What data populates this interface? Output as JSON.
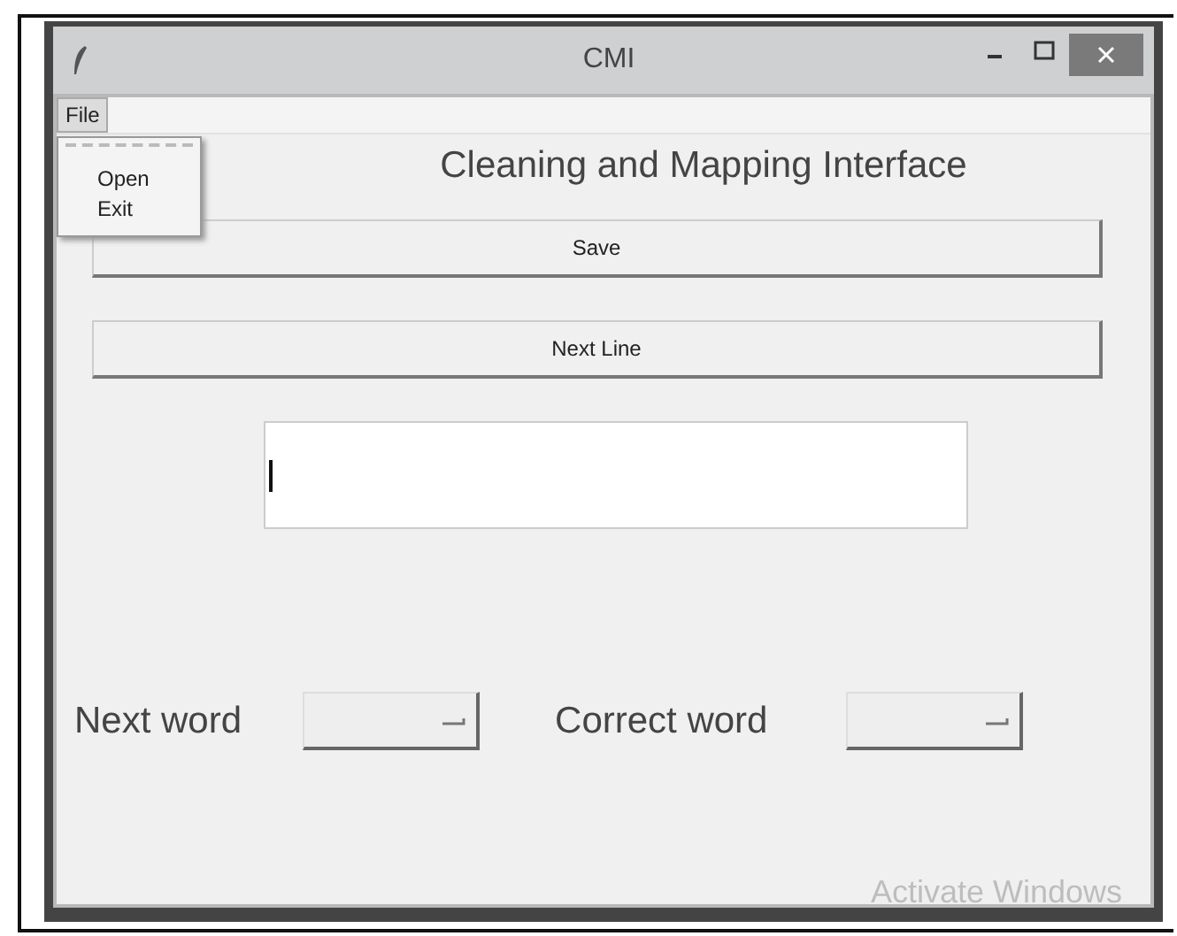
{
  "window": {
    "title": "CMI"
  },
  "menubar": [
    {
      "label": "File",
      "open": true,
      "items": [
        "Open",
        "Exit"
      ]
    }
  ],
  "heading": "Cleaning and Mapping Interface",
  "buttons": [
    "Save",
    "Next Line"
  ],
  "text_entry": {
    "focused": true
  },
  "selectors": [
    {
      "label": "Next word"
    },
    {
      "label": "Correct word"
    }
  ],
  "activation_notice": "Activate Windows"
}
